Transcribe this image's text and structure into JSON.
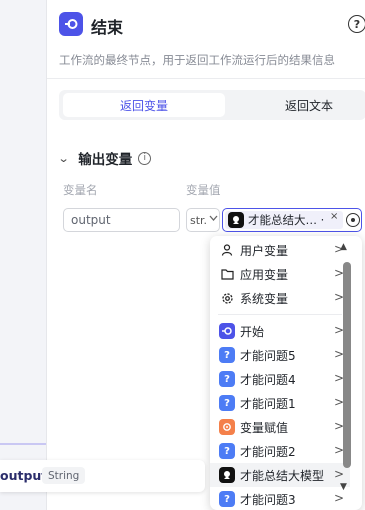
{
  "header": {
    "title": "结束",
    "help_glyph": "?"
  },
  "description": "工作流的最终节点，用于返回工作流运行后的结果信息",
  "tabs": [
    {
      "label": "返回变量",
      "active": true
    },
    {
      "label": "返回文本",
      "active": false
    }
  ],
  "output_section": {
    "title": "输出变量",
    "info_glyph": "i",
    "col_name": "变量名",
    "col_value": "变量值",
    "row": {
      "name": "output",
      "type_short": "str.",
      "value": "才能总结大…",
      "value_suffix": "·"
    }
  },
  "dropdown": {
    "groups": [
      {
        "label": "用户变量",
        "icon": "user-icon"
      },
      {
        "label": "应用变量",
        "icon": "folder-icon"
      },
      {
        "label": "系统变量",
        "icon": "gear-icon"
      }
    ],
    "nodes": [
      {
        "label": "开始",
        "icon": "start-node-icon",
        "color": "#4d53e8"
      },
      {
        "label": "才能问题5",
        "icon": "question-node-icon",
        "color": "#4d7cf5"
      },
      {
        "label": "才能问题4",
        "icon": "question-node-icon",
        "color": "#4d7cf5"
      },
      {
        "label": "才能问题1",
        "icon": "question-node-icon",
        "color": "#4d7cf5"
      },
      {
        "label": "变量赋值",
        "icon": "assign-node-icon",
        "color": "#f4804a"
      },
      {
        "label": "才能问题2",
        "icon": "question-node-icon",
        "color": "#4d7cf5"
      },
      {
        "label": "才能总结大模型",
        "icon": "llm-node-icon",
        "color": "#111111"
      },
      {
        "label": "才能问题3",
        "icon": "question-node-icon",
        "color": "#4d7cf5"
      }
    ]
  },
  "canvas_output": {
    "name": "output",
    "type": "String"
  },
  "colors": {
    "accent": "#4d53e8"
  }
}
